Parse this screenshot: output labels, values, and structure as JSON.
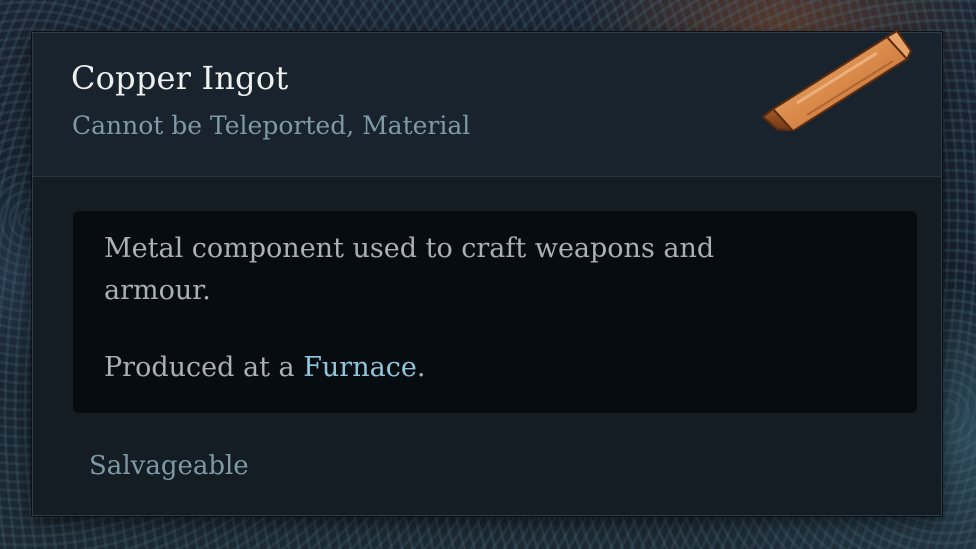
{
  "tooltip": {
    "item_name": "Copper Ingot",
    "item_tags": "Cannot be Teleported, Material",
    "icon": "copper-ingot-icon",
    "description": {
      "line1": "Metal component used to craft weapons and",
      "line2": "armour.",
      "line3_prefix": "Produced at a ",
      "line3_link": "Furnace",
      "line3_suffix": "."
    },
    "footer": "Salvageable"
  },
  "colors": {
    "title": "#eef0ee",
    "tags": "#7f9aa6",
    "body_text": "#a9b1b2",
    "link": "#8fc7de",
    "panel_bg": "#141c24",
    "header_bg": "#19232e",
    "desc_bg": "#070c10",
    "copper": "#c8743a"
  }
}
